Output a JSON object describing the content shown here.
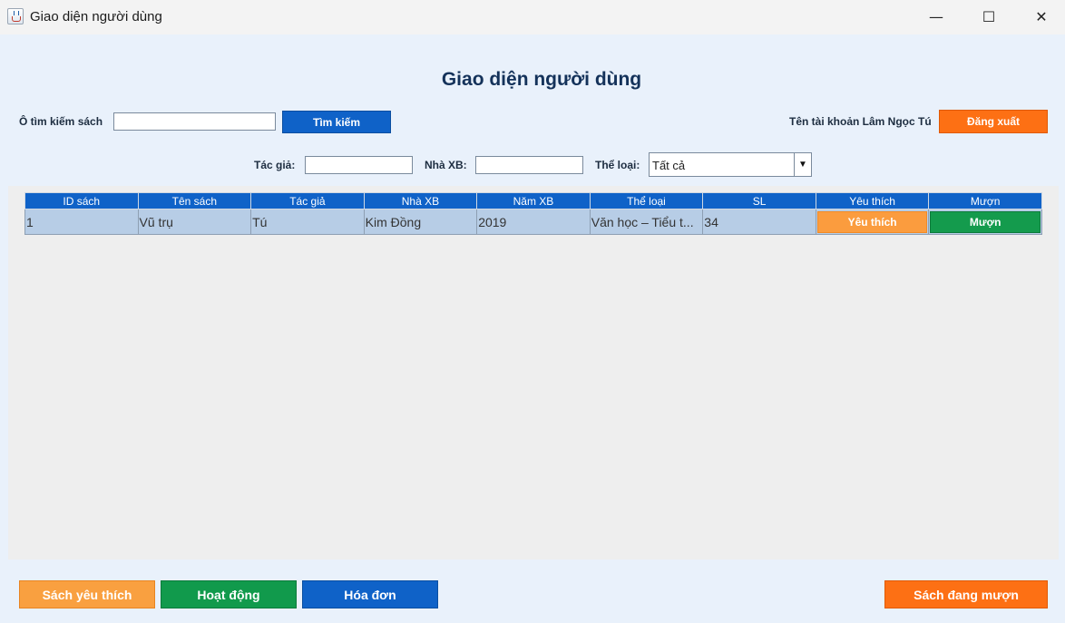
{
  "window": {
    "title": "Giao diện người dùng",
    "controls": {
      "minimize": "—",
      "maximize": "☐",
      "close": "✕"
    }
  },
  "header": {
    "title": "Giao diện người dùng"
  },
  "search": {
    "label": "Ô tìm kiếm sách",
    "value": "",
    "button": "Tìm kiếm"
  },
  "account": {
    "label": "Tên tài khoản Lâm Ngọc Tú",
    "logout": "Đăng xuất"
  },
  "filters": {
    "author_label": "Tác giả:",
    "author_value": "",
    "publisher_label": "Nhà XB:",
    "publisher_value": "",
    "genre_label": "Thể loại:",
    "genre_selected": "Tất cả"
  },
  "table": {
    "columns": [
      "ID sách",
      "Tên sách",
      "Tác giả",
      "Nhà XB",
      "Năm XB",
      "Thể loại",
      "SL",
      "Yêu thích",
      "Mượn"
    ],
    "rows": [
      {
        "id": "1",
        "name": "Vũ trụ",
        "author": "Tú",
        "publisher": "Kim Đồng",
        "year": "2019",
        "genre": "Văn học – Tiểu t...",
        "qty": "34",
        "favorite": "Yêu thích",
        "borrow": "Mượn"
      }
    ]
  },
  "footer": {
    "favorites": "Sách yêu thích",
    "activity": "Hoạt động",
    "invoices": "Hóa đơn",
    "borrowing": "Sách đang mượn"
  },
  "colors": {
    "primary": "#0f62c8",
    "orange": "#fd7014",
    "light_orange": "#f9a040",
    "green": "#119a4c",
    "title": "#14325a",
    "background": "#e9f1fb"
  },
  "icons": {
    "app": "java-cup-icon",
    "genre_dropdown": "triangle-down-icon"
  }
}
